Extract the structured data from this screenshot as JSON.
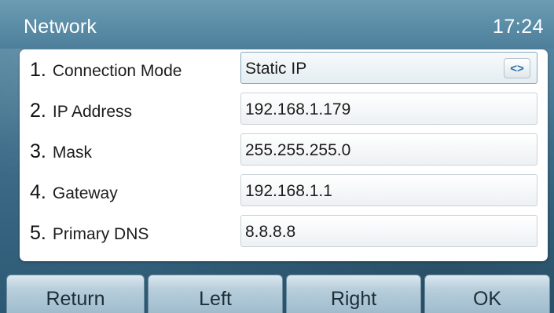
{
  "header": {
    "title": "Network",
    "time": "17:24"
  },
  "rows": [
    {
      "number": "1.",
      "label": "Connection Mode",
      "value": "Static IP"
    },
    {
      "number": "2.",
      "label": "IP Address",
      "value": "192.168.1.179"
    },
    {
      "number": "3.",
      "label": "Mask",
      "value": "255.255.255.0"
    },
    {
      "number": "4.",
      "label": "Gateway",
      "value": "192.168.1.1"
    },
    {
      "number": "5.",
      "label": "Primary DNS",
      "value": "8.8.8.8"
    }
  ],
  "switch_icon": "<>",
  "softkeys": {
    "return_label": "Return",
    "left_label": "Left",
    "right_label": "Right",
    "ok_label": "OK"
  },
  "colors": {
    "title_bar": "#5d8fa8",
    "panel": "#ffffff",
    "softkey": "#b9cfdc",
    "switch_icon": "#2a6fa6"
  }
}
